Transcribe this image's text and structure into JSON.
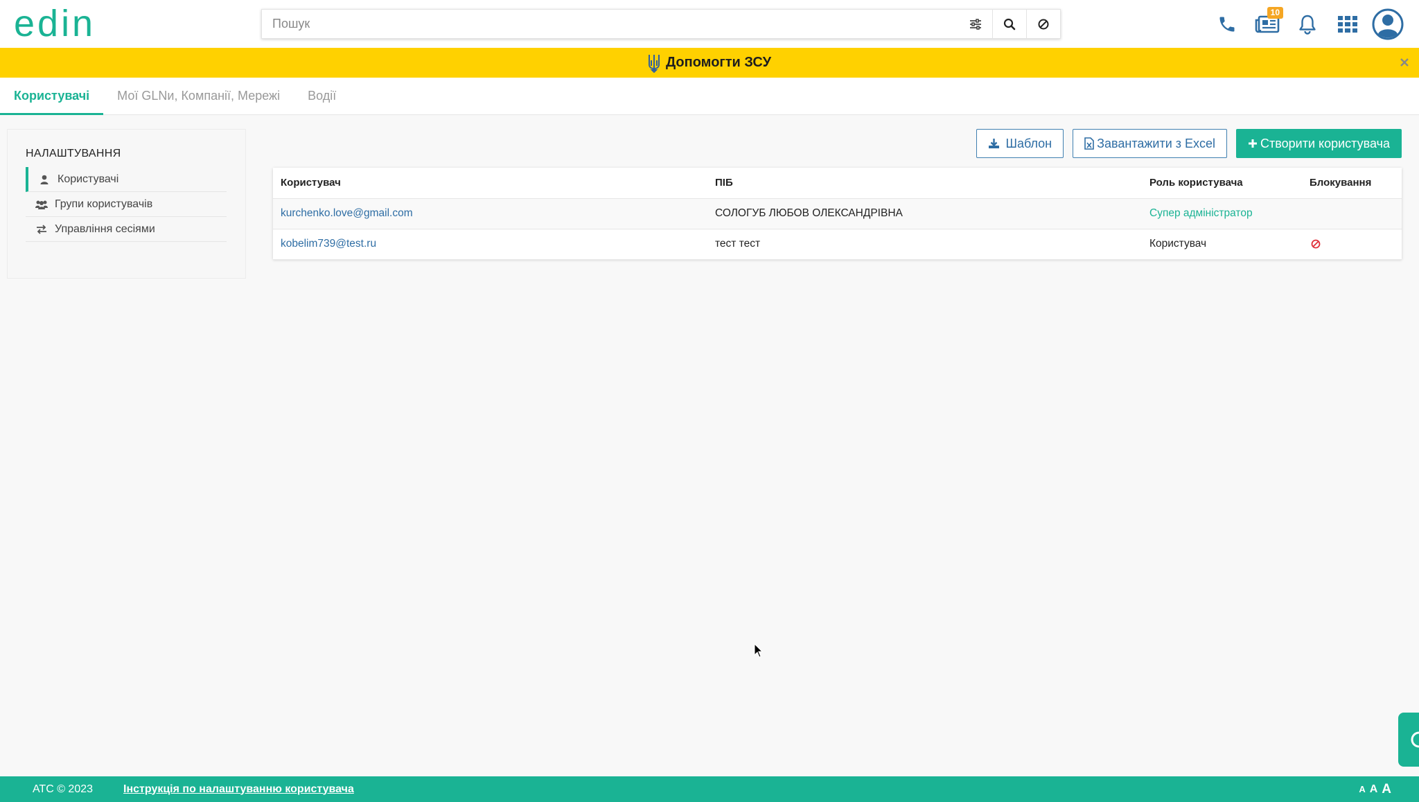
{
  "header": {
    "logo_text": "edin",
    "search": {
      "placeholder": "Пошук",
      "value": ""
    },
    "icons": [
      "filter-sliders-icon",
      "search-icon",
      "clear-icon",
      "phone-icon",
      "news-icon",
      "bell-icon",
      "apps-grid-icon",
      "user-avatar-icon"
    ],
    "news_badge": "10"
  },
  "banner": {
    "text": "Допомогти ЗСУ",
    "color": "#ffd100"
  },
  "tabs": [
    {
      "label": "Користувачі",
      "active": true
    },
    {
      "label": "Мої GLNи, Компанії, Мережі",
      "active": false
    },
    {
      "label": "Водії",
      "active": false
    }
  ],
  "sidebar": {
    "title": "НАЛАШТУВАННЯ",
    "items": [
      {
        "label": "Користувачі",
        "icon": "user-icon",
        "active": true
      },
      {
        "label": "Групи користувачів",
        "icon": "users-group-icon",
        "active": false
      },
      {
        "label": "Управління сесіями",
        "icon": "exchange-icon",
        "active": false
      }
    ]
  },
  "actions": {
    "template_label": "Шаблон",
    "excel_label": "Завантажити з Excel",
    "create_label": "Створити користувача"
  },
  "table": {
    "headers": [
      "Користувач",
      "ПІБ",
      "Роль користувача",
      "Блокування"
    ],
    "rows": [
      {
        "user": "kurchenko.love@gmail.com",
        "name": "СОЛОГУБ ЛЮБОВ ОЛЕКСАНДРІВНА",
        "role": "Супер адміністратор",
        "blocked": false
      },
      {
        "user": "kobelim739@test.ru",
        "name": "тест тест",
        "role": "Користувач",
        "blocked": true
      }
    ]
  },
  "footer": {
    "copyright": "АТС © 2023",
    "instruction_link": "Інструкція по налаштуванню користувача",
    "font_sizes": [
      "A",
      "A",
      "A"
    ]
  },
  "colors": {
    "accent": "#1ab394",
    "link": "#2e6da4",
    "banner": "#ffd100",
    "danger": "#e0303a"
  }
}
